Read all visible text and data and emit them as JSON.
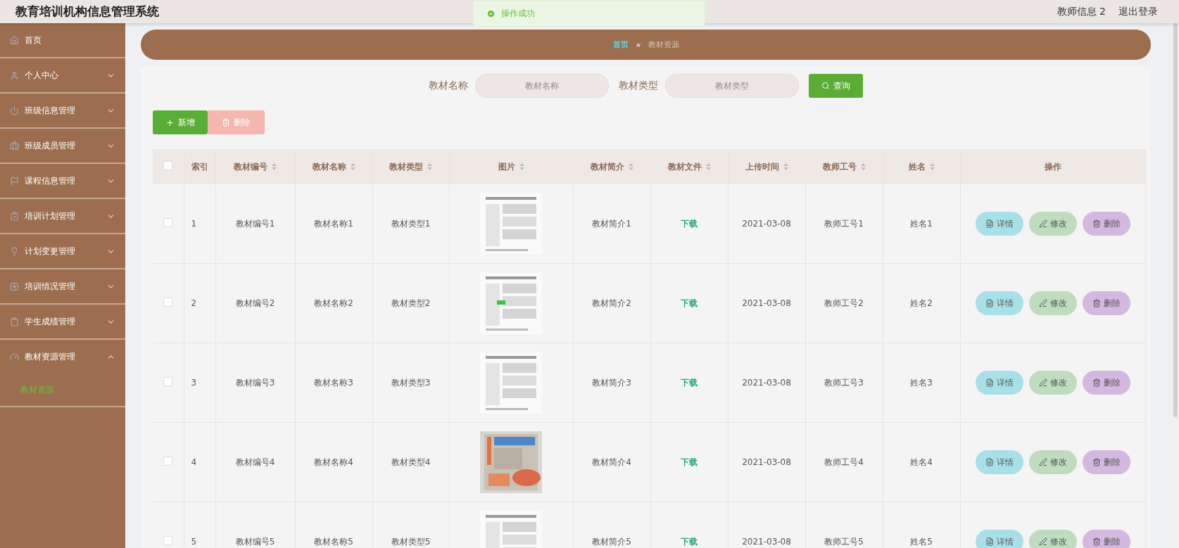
{
  "header": {
    "title": "教育培训机构信息管理系统",
    "user": "教师信息 2",
    "logout": "退出登录"
  },
  "toast": {
    "message": "操作成功"
  },
  "sidebar": {
    "items": [
      {
        "label": "首页"
      },
      {
        "label": "个人中心",
        "expanded": false
      },
      {
        "label": "班级信息管理",
        "expanded": false
      },
      {
        "label": "班级成员管理",
        "expanded": false
      },
      {
        "label": "课程信息管理",
        "expanded": false
      },
      {
        "label": "培训计划管理",
        "expanded": false
      },
      {
        "label": "计划变更管理",
        "expanded": false
      },
      {
        "label": "培训情况管理",
        "expanded": false
      },
      {
        "label": "学生成绩管理",
        "expanded": false
      },
      {
        "label": "教材资源管理",
        "expanded": true,
        "children": [
          {
            "label": "教材资源",
            "selected": true
          }
        ]
      }
    ]
  },
  "breadcrumb": [
    "首页",
    "教材资源"
  ],
  "search": {
    "fields": [
      {
        "label": "教材名称",
        "placeholder": "教材名称"
      },
      {
        "label": "教材类型",
        "placeholder": "教材类型"
      }
    ],
    "button": "查询"
  },
  "actions": {
    "add": "新增",
    "delete": "删除",
    "delete_disabled": true
  },
  "table": {
    "select_all_checked": false,
    "columns": [
      {
        "label": "索引",
        "sortable": false
      },
      {
        "label": "教材编号",
        "sortable": true
      },
      {
        "label": "教材名称",
        "sortable": true
      },
      {
        "label": "教材类型",
        "sortable": true
      },
      {
        "label": "图片",
        "sortable": true
      },
      {
        "label": "教材简介",
        "sortable": true
      },
      {
        "label": "教材文件",
        "sortable": true
      },
      {
        "label": "上传时间",
        "sortable": true
      },
      {
        "label": "教师工号",
        "sortable": true
      },
      {
        "label": "姓名",
        "sortable": true
      },
      {
        "label": "操作",
        "sortable": false
      }
    ],
    "rows": [
      {
        "checked": false,
        "index": "1",
        "code": "教材编号1",
        "name": "教材名称1",
        "type": "教材类型1",
        "intro": "教材简介1",
        "file": "下载",
        "time": "2021-03-08",
        "teacher_id": "教师工号1",
        "teacher_name": "姓名1",
        "buttons": [
          "详情",
          "修改",
          "删除"
        ]
      },
      {
        "checked": false,
        "index": "2",
        "code": "教材编号2",
        "name": "教材名称2",
        "type": "教材类型2",
        "intro": "教材简介2",
        "file": "下载",
        "time": "2021-03-08",
        "teacher_id": "教师工号2",
        "teacher_name": "姓名2",
        "buttons": [
          "详情",
          "修改",
          "删除"
        ]
      },
      {
        "checked": false,
        "index": "3",
        "code": "教材编号3",
        "name": "教材名称3",
        "type": "教材类型3",
        "intro": "教材简介3",
        "file": "下载",
        "time": "2021-03-08",
        "teacher_id": "教师工号3",
        "teacher_name": "姓名3",
        "buttons": [
          "详情",
          "修改",
          "删除"
        ]
      },
      {
        "checked": false,
        "index": "4",
        "code": "教材编号4",
        "name": "教材名称4",
        "type": "教材类型4",
        "intro": "教材简介4",
        "file": "下载",
        "time": "2021-03-08",
        "teacher_id": "教师工号4",
        "teacher_name": "姓名4",
        "buttons": [
          "详情",
          "修改",
          "删除"
        ]
      },
      {
        "checked": false,
        "index": "5",
        "code": "教材编号5",
        "name": "教材名称5",
        "type": "教材类型5",
        "intro": "教材简介5",
        "file": "下载",
        "time": "2021-03-08",
        "teacher_id": "教师工号5",
        "teacher_name": "姓名5",
        "buttons": [
          "详情",
          "修改",
          "删除"
        ]
      }
    ]
  }
}
